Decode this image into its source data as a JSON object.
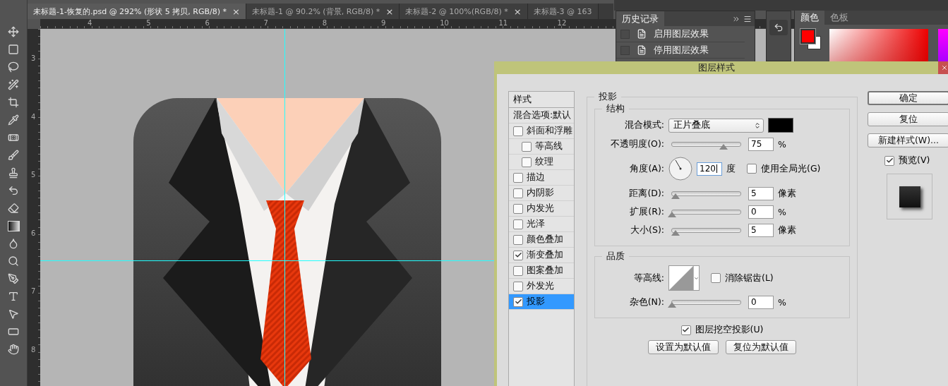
{
  "tabs": [
    {
      "label": "未标题-1-恢复的.psd @ 292% (形状 5 拷贝, RGB/8) *",
      "selected": true,
      "close": "×"
    },
    {
      "label": "未标题-1 @ 90.2% (背景, RGB/8) *",
      "selected": false,
      "close": "×"
    },
    {
      "label": "未标题-2 @ 100%(RGB/8) *",
      "selected": false,
      "close": "×"
    },
    {
      "label": "未标题-3 @ 163",
      "selected": false
    }
  ],
  "rulers": {
    "horizontal": [
      "4",
      "5",
      "6",
      "7",
      "8",
      "9",
      "10",
      "11",
      "12"
    ],
    "vertical": [
      "3",
      "4",
      "5",
      "6",
      "7",
      "8"
    ]
  },
  "history_panel": {
    "title": "历史记录",
    "items": [
      {
        "label": "启用图层效果",
        "checked": false
      },
      {
        "label": "停用图层效果",
        "checked": false
      }
    ]
  },
  "color_panel": {
    "tabs": [
      {
        "label": "颜色",
        "selected": true
      },
      {
        "label": "色板",
        "selected": false
      }
    ]
  },
  "dialog": {
    "title": "图层样式",
    "style_list": {
      "heading": "样式",
      "items": [
        {
          "kind": "plain",
          "label": "混合选项:默认",
          "selected": false
        },
        {
          "kind": "effect",
          "label": "斜面和浮雕",
          "checked": false,
          "selected": false,
          "children": [
            {
              "kind": "effect",
              "label": "等高线",
              "checked": false,
              "selected": false
            },
            {
              "kind": "effect",
              "label": "纹理",
              "checked": false,
              "selected": false
            }
          ]
        },
        {
          "kind": "effect",
          "label": "描边",
          "checked": false,
          "selected": false
        },
        {
          "kind": "effect",
          "label": "内阴影",
          "checked": false,
          "selected": false
        },
        {
          "kind": "effect",
          "label": "内发光",
          "checked": false,
          "selected": false
        },
        {
          "kind": "effect",
          "label": "光泽",
          "checked": false,
          "selected": false
        },
        {
          "kind": "effect",
          "label": "颜色叠加",
          "checked": false,
          "selected": false
        },
        {
          "kind": "effect",
          "label": "渐变叠加",
          "checked": true,
          "selected": false
        },
        {
          "kind": "effect",
          "label": "图案叠加",
          "checked": false,
          "selected": false
        },
        {
          "kind": "effect",
          "label": "外发光",
          "checked": false,
          "selected": false
        },
        {
          "kind": "effect",
          "label": "投影",
          "checked": true,
          "selected": true
        }
      ]
    },
    "section_title": "投影",
    "structure": {
      "title": "结构",
      "rows": [
        {
          "kind": "select",
          "label": "混合模式:",
          "value": "正片叠底"
        },
        {
          "kind": "slider",
          "label": "不透明度(O):",
          "level": 0.75,
          "value": "75",
          "unit": "%"
        },
        {
          "kind": "angle",
          "label": "角度(A):",
          "value": "120",
          "focused": true,
          "unit": "度",
          "option": {
            "label": "使用全局光(G)",
            "checked": false
          }
        },
        {
          "kind": "slider",
          "label": "距离(D):",
          "level": 0.05,
          "value": "5",
          "unit": "像素"
        },
        {
          "kind": "slider",
          "label": "扩展(R):",
          "level": 0,
          "value": "0",
          "unit": "%"
        },
        {
          "kind": "slider",
          "label": "大小(S):",
          "level": 0.05,
          "value": "5",
          "unit": "像素"
        }
      ]
    },
    "quality": {
      "title": "品质",
      "rows": [
        {
          "kind": "contour",
          "label": "等高线:",
          "option": {
            "label": "消除锯齿(L)",
            "checked": false
          }
        },
        {
          "kind": "slider",
          "label": "杂色(N):",
          "level": 0,
          "value": "0",
          "unit": "%"
        }
      ]
    },
    "knockout": {
      "label": "图层挖空投影(U)",
      "checked": true
    },
    "default_buttons": [
      "设置为默认值",
      "复位为默认值"
    ],
    "side_buttons": [
      {
        "label": "确定",
        "default": true
      },
      {
        "label": "复位",
        "default": false
      },
      {
        "label": "新建样式(W)...",
        "default": false
      }
    ],
    "preview": {
      "label": "预览(V)",
      "checked": true
    }
  }
}
